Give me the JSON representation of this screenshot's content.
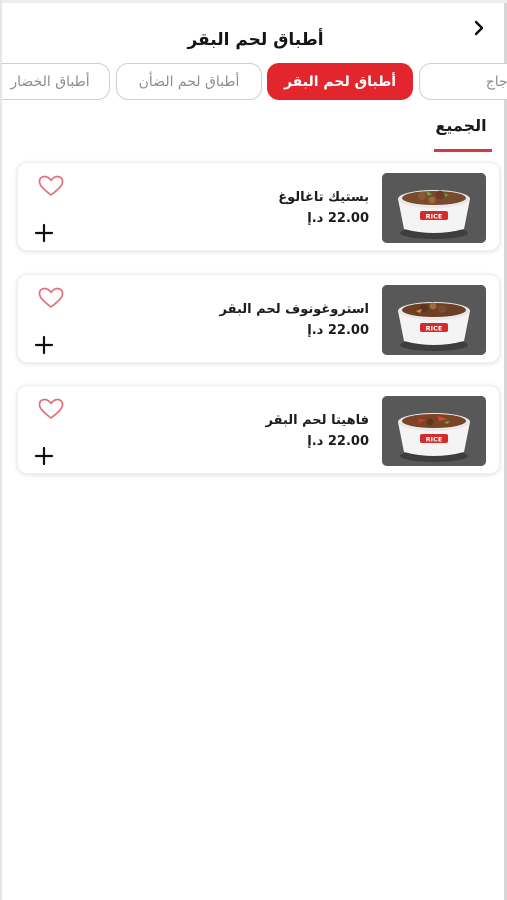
{
  "header": {
    "title": "أطباق لحم البقر",
    "back_icon": "chevron-icon"
  },
  "tabs": [
    {
      "label": "أطباق الخضار",
      "active": false
    },
    {
      "label": "أطباق لحم الضأن",
      "active": false
    },
    {
      "label": "أطباق لحم البقر",
      "active": true
    },
    {
      "label": "أطباق الدجاج",
      "active": false
    }
  ],
  "section": {
    "label": "الجميع"
  },
  "products": [
    {
      "name": "بستيك تاغالوغ",
      "price": "22.00 د.إ"
    },
    {
      "name": "استروغونوف لحم البقر",
      "price": "22.00 د.إ"
    },
    {
      "name": "فاهيتا لحم البقر",
      "price": "22.00 د.إ"
    }
  ],
  "colors": {
    "accent": "#e3262d",
    "heart": "#e2707a",
    "tab_border": "#cfcfcf"
  }
}
